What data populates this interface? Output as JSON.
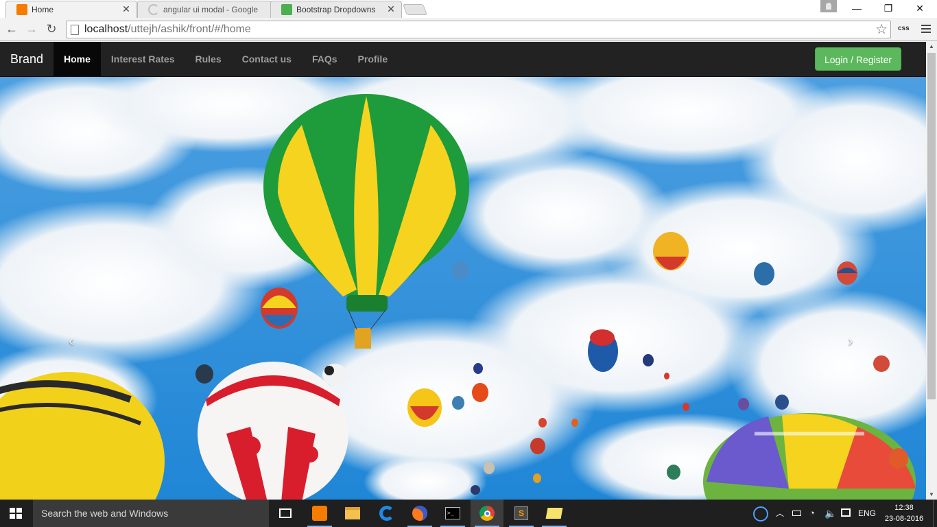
{
  "browser": {
    "tabs": [
      {
        "title": "Home",
        "active": true,
        "favicon": "xampp-icon",
        "favicon_color": "#f57c00"
      },
      {
        "title": "angular ui modal - Google",
        "active": false,
        "favicon": "loading-icon",
        "favicon_color": "#9e9e9e"
      },
      {
        "title": "Bootstrap Dropdowns",
        "active": false,
        "favicon": "w3schools-icon",
        "favicon_color": "#4caf50"
      }
    ],
    "tab_close": "✕",
    "window_controls": {
      "minimize": "—",
      "restore": "❐",
      "close": "✕"
    },
    "url_host": "localhost",
    "url_path": "/uttejh/ashik/front/#/home",
    "extension_label": "css"
  },
  "page": {
    "brand": "Brand",
    "nav_items": [
      {
        "label": "Home",
        "active": true
      },
      {
        "label": "Interest Rates",
        "active": false
      },
      {
        "label": "Rules",
        "active": false
      },
      {
        "label": "Contact us",
        "active": false
      },
      {
        "label": "FAQs",
        "active": false
      },
      {
        "label": "Profile",
        "active": false
      }
    ],
    "login_button": "Login / Register",
    "carousel": {
      "prev": "‹",
      "next": "›",
      "image": "hot-air-balloons-sky"
    }
  },
  "colors": {
    "navbar_bg": "#222222",
    "nav_active_bg": "#080808",
    "login_green": "#5cb85c",
    "sky_blue": "#2f8fd8",
    "taskbar_bg": "#1f1f1f"
  },
  "taskbar": {
    "search_placeholder": "Search the web and Windows",
    "apps": [
      "task-view-icon",
      "xampp-icon",
      "file-explorer-icon",
      "edge-icon",
      "firefox-icon",
      "cmd-icon",
      "chrome-icon",
      "sublime-icon",
      "sticky-notes-icon"
    ],
    "language": "ENG",
    "time": "12:38",
    "date": "23-08-2016"
  }
}
